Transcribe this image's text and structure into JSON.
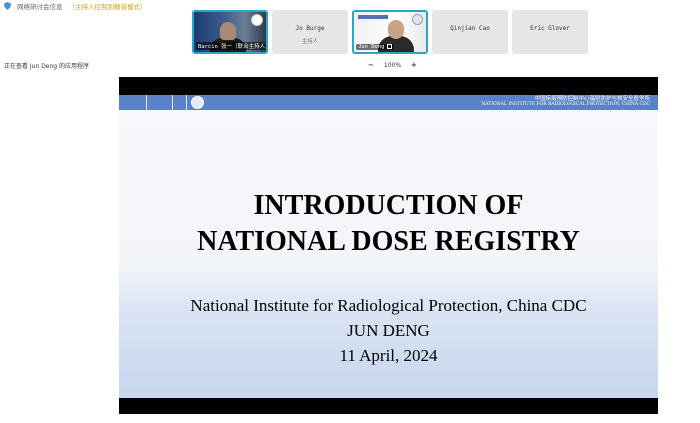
{
  "topbar": {
    "meeting_info": "网络研讨会信息",
    "host_mode": "（主持人控制到静音模式）"
  },
  "participants": [
    {
      "name": "Barcin 张一（联合主持人）",
      "type": "video"
    },
    {
      "name": "Jo Burge",
      "role": "主持人",
      "type": "plain"
    },
    {
      "name": "Jun Deng",
      "type": "video"
    },
    {
      "name": "Qinjian Cao",
      "type": "plain"
    },
    {
      "name": "Eric Glover",
      "type": "plain"
    }
  ],
  "viewing": "正在查看 Jun Deng 的应用程序",
  "zoom": {
    "minus": "−",
    "level": "100%",
    "plus": "+"
  },
  "slide": {
    "institute_zh": "中国疾病预防控制中心辐射防护与核安全医学所",
    "institute_en": "NATIONAL INSTITUTE FOR RADIOLOGICAL PROTECTION, CHINA CDC",
    "title_line1": "INTRODUCTION OF",
    "title_line2": "NATIONAL DOSE REGISTRY",
    "org": "National Institute for Radiological Protection, China CDC",
    "author": "JUN DENG",
    "date": "11 April, 2024"
  },
  "colors": {
    "accent_border": "#2aa6c9",
    "banner": "#5a82c4",
    "host_mode": "#c9a227"
  }
}
